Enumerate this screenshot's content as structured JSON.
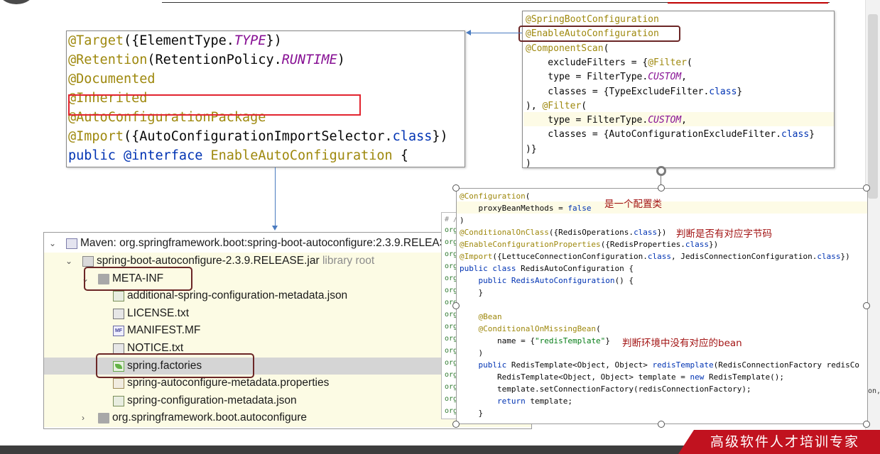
{
  "enable_panel": {
    "line1": {
      "a": "@Target",
      "b": "({ElementType.",
      "c": "TYPE",
      "d": "})"
    },
    "line2": {
      "a": "@Retention",
      "b": "(RetentionPolicy.",
      "c": "RUNTIME",
      "d": ")"
    },
    "line3": "@Documented",
    "line4": "@Inherited",
    "line5": "@AutoConfigurationPackage",
    "line6": {
      "a": "@Import",
      "b": "({",
      "c": "AutoConfigurationImportSelector.",
      "d": "class",
      "e": "})"
    },
    "line7": {
      "a": "public @",
      "b": "interface",
      "c": " ",
      "d": "EnableAutoConfiguration",
      "e": " {"
    }
  },
  "sbc_panel": {
    "lines": [
      {
        "ann": "@SpringBootConfiguration"
      },
      {
        "ann": "@EnableAutoConfiguration"
      },
      {
        "ann": "@ComponentScan",
        "txt": "("
      },
      {
        "pre": "    excludeFilters = {",
        "ann": "@Filter",
        "txt": "("
      },
      {
        "pre": "    type = FilterType.",
        "it": "CUSTOM",
        "txt": ","
      },
      {
        "pre": "    classes = {TypeExcludeFilter.",
        "kw": "class",
        "txt": "}"
      },
      {
        "pre": "), ",
        "ann": "@Filter",
        "txt": "("
      },
      {
        "pre": "    type = FilterType.",
        "it": "CUSTOM",
        "txt": ","
      },
      {
        "pre": "    classes = {AutoConfigurationExcludeFilter.",
        "kw": "class",
        "txt": "}"
      },
      {
        "pre": ")}"
      },
      {
        "pre": ")"
      }
    ]
  },
  "tree": {
    "maven_root": "Maven: org.springframework.boot:spring-boot-autoconfigure:2.3.9.RELEASE",
    "jar_name": "spring-boot-autoconfigure-2.3.9.RELEASE.jar",
    "jar_suffix": "library root",
    "meta_inf": "META-INF",
    "files": [
      "additional-spring-configuration-metadata.json",
      "LICENSE.txt",
      "MANIFEST.MF",
      "NOTICE.txt",
      "spring.factories",
      "spring-autoconfigure-metadata.properties",
      "spring-configuration-metadata.json"
    ],
    "package": "org.springframework.boot.autoconfigure",
    "mf_icon_text": "MF"
  },
  "org_strip": {
    "header": "# /",
    "prefix": "org"
  },
  "redis_panel": {
    "lines": [
      {
        "ann": "@Configuration",
        "txt": "("
      },
      {
        "pre": "    proxyBeanMethods = ",
        "kw": "false"
      },
      {
        "pre": ")"
      },
      {
        "ann": "@ConditionalOnClass",
        "txt": "({RedisOperations.",
        "kw": "class",
        "tail": "})"
      },
      {
        "ann": "@EnableConfigurationProperties",
        "txt": "({RedisProperties.",
        "kw": "class",
        "tail": "})"
      },
      {
        "ann": "@Import",
        "txt": "({LettuceConnectionConfiguration.",
        "kw": "class",
        "tail": ", JedisConnectionConfiguration.",
        "kw2": "class",
        "tail2": "})"
      },
      {
        "kwpre": "public class ",
        "txt": "RedisAutoConfiguration {"
      },
      {
        "kwpre": "    public ",
        "kw": "RedisAutoConfiguration",
        "txt": "() {"
      },
      {
        "pre": "    }"
      },
      {
        "pre": ""
      },
      {
        "ann": "    @Bean"
      },
      {
        "ann": "    @ConditionalOnMissingBean",
        "txt": "("
      },
      {
        "pre": "        name = {",
        "str": "\"redisTemplate\"",
        "txt": "}"
      },
      {
        "pre": "    )"
      },
      {
        "kwpre": "    public ",
        "txt": "RedisTemplate<Object, Object> ",
        "kw": "redisTemplate",
        "tail": "(RedisConnectionFactory redisCo"
      },
      {
        "pre": "        RedisTemplate<Object, Object> template = ",
        "kw": "new",
        "tail": " RedisTemplate();"
      },
      {
        "pre": "        template.setConnectionFactory(redisConnectionFactory);"
      },
      {
        "kwpre": "        return ",
        "txt": "template;"
      },
      {
        "pre": "    }"
      }
    ],
    "notes": {
      "config_class": "是一个配置类",
      "has_bytecode": "判断是否有对应字节码",
      "no_bean": "判断环境中没有对应的bean"
    },
    "edge_text": "on,"
  },
  "brand": "高级软件人才培训专家",
  "colors": {
    "annotation": "#9e880d",
    "keyword": "#0033b3",
    "constant": "#871094",
    "highlight_red": "#e2242f",
    "brand_red": "#c1121f"
  }
}
